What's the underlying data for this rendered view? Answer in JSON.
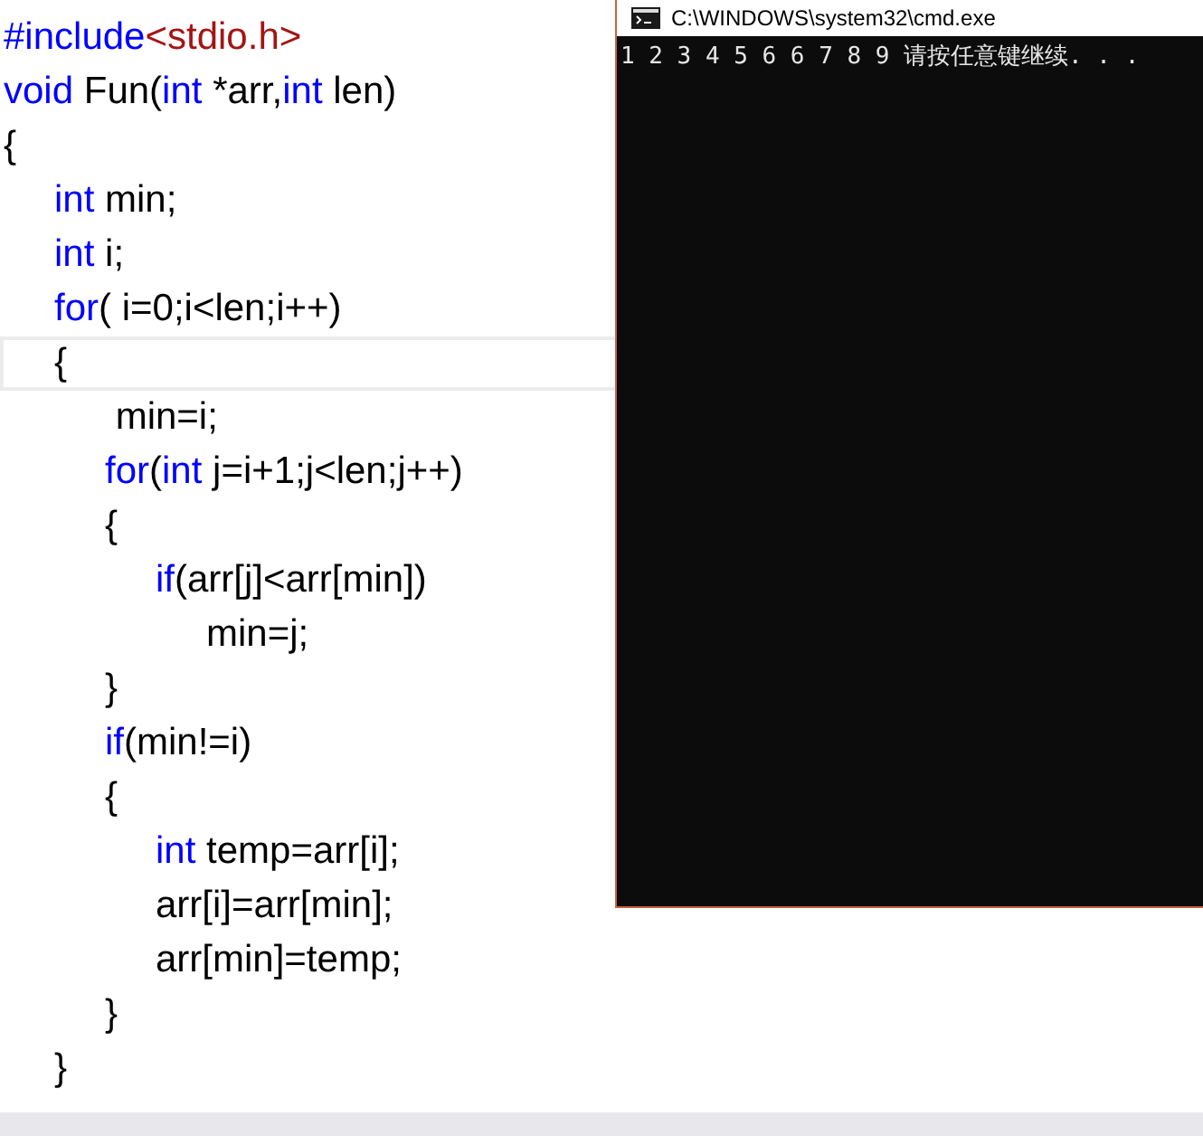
{
  "editor": {
    "lines": [
      {
        "current": false,
        "tokens": [
          {
            "kind": "keyword",
            "text": "#include"
          },
          {
            "kind": "string",
            "text": "<stdio.h>"
          }
        ]
      },
      {
        "current": false,
        "tokens": [
          {
            "kind": "keyword",
            "text": "void"
          },
          {
            "kind": "plain",
            "text": " Fun("
          },
          {
            "kind": "keyword",
            "text": "int"
          },
          {
            "kind": "plain",
            "text": " *arr,"
          },
          {
            "kind": "keyword",
            "text": "int"
          },
          {
            "kind": "plain",
            "text": " len)"
          }
        ]
      },
      {
        "current": false,
        "tokens": [
          {
            "kind": "plain",
            "text": "{"
          }
        ],
        "children": [
          {
            "current": false,
            "tokens": [
              {
                "kind": "keyword",
                "text": "int"
              },
              {
                "kind": "plain",
                "text": " min;"
              }
            ]
          },
          {
            "current": false,
            "tokens": [
              {
                "kind": "keyword",
                "text": "int"
              },
              {
                "kind": "plain",
                "text": " i;"
              }
            ]
          },
          {
            "current": false,
            "tokens": [
              {
                "kind": "keyword",
                "text": "for"
              },
              {
                "kind": "plain",
                "text": "( i=0;i<len;i++)"
              }
            ]
          },
          {
            "current": true,
            "tokens": [
              {
                "kind": "plain",
                "text": "{"
              }
            ],
            "children": [
              {
                "current": false,
                "tokens": [
                  {
                    "kind": "plain",
                    "text": " min=i;"
                  }
                ]
              },
              {
                "current": false,
                "tokens": [
                  {
                    "kind": "keyword",
                    "text": "for"
                  },
                  {
                    "kind": "plain",
                    "text": "("
                  },
                  {
                    "kind": "keyword",
                    "text": "int"
                  },
                  {
                    "kind": "plain",
                    "text": " j=i+1;j<len;j++)"
                  }
                ]
              },
              {
                "current": false,
                "tokens": [
                  {
                    "kind": "plain",
                    "text": "{"
                  }
                ],
                "children": [
                  {
                    "current": false,
                    "tokens": [
                      {
                        "kind": "keyword",
                        "text": "if"
                      },
                      {
                        "kind": "plain",
                        "text": "(arr[j]<arr[min])"
                      }
                    ],
                    "children": [
                      {
                        "current": false,
                        "tokens": [
                          {
                            "kind": "plain",
                            "text": "min=j;"
                          }
                        ]
                      }
                    ]
                  }
                ]
              },
              {
                "current": false,
                "tokens": [
                  {
                    "kind": "plain",
                    "text": "}"
                  }
                ]
              },
              {
                "current": false,
                "tokens": [
                  {
                    "kind": "keyword",
                    "text": "if"
                  },
                  {
                    "kind": "plain",
                    "text": "(min!=i)"
                  }
                ]
              },
              {
                "current": false,
                "tokens": [
                  {
                    "kind": "plain",
                    "text": "{"
                  }
                ],
                "children": [
                  {
                    "current": false,
                    "tokens": [
                      {
                        "kind": "keyword",
                        "text": "int"
                      },
                      {
                        "kind": "plain",
                        "text": " temp=arr[i];"
                      }
                    ]
                  },
                  {
                    "current": false,
                    "tokens": [
                      {
                        "kind": "plain",
                        "text": "arr[i]=arr[min];"
                      }
                    ]
                  },
                  {
                    "current": false,
                    "tokens": [
                      {
                        "kind": "plain",
                        "text": "arr[min]=temp;"
                      }
                    ]
                  }
                ]
              },
              {
                "current": false,
                "tokens": [
                  {
                    "kind": "plain",
                    "text": "}"
                  }
                ]
              }
            ]
          },
          {
            "current": false,
            "tokens": [
              {
                "kind": "plain",
                "text": "}"
              }
            ]
          }
        ]
      }
    ]
  },
  "console": {
    "title": "C:\\WINDOWS\\system32\\cmd.exe",
    "output": "1 2 3 4 5 6 6 7 8 9 请按任意键继续. . ."
  }
}
